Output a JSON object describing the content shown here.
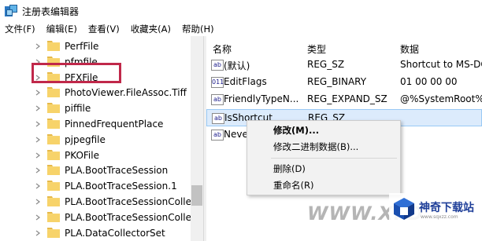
{
  "window": {
    "title": "注册表编辑器"
  },
  "menu": [
    {
      "label": "文件(F)"
    },
    {
      "label": "编辑(E)"
    },
    {
      "label": "查看(V)"
    },
    {
      "label": "收藏夹(A)"
    },
    {
      "label": "帮助(H)"
    }
  ],
  "tree": {
    "items": [
      {
        "label": "PerfFile"
      },
      {
        "label": "pfmfile"
      },
      {
        "label": "PFXFile"
      },
      {
        "label": "PhotoViewer.FileAssoc.Tiff"
      },
      {
        "label": "piffile",
        "highlighted": true
      },
      {
        "label": "PinnedFrequentPlace"
      },
      {
        "label": "pjpegfile"
      },
      {
        "label": "PKOFile"
      },
      {
        "label": "PLA.BootTraceSession"
      },
      {
        "label": "PLA.BootTraceSession.1"
      },
      {
        "label": "PLA.BootTraceSessionCollec"
      },
      {
        "label": "PLA.BootTraceSessionCollec"
      },
      {
        "label": "PLA.DataCollectorSet"
      }
    ]
  },
  "values_table": {
    "headers": {
      "name": "名称",
      "type": "类型",
      "data": "数据"
    },
    "rows": [
      {
        "icon": "string-value-icon",
        "name": "(默认)",
        "type": "REG_SZ",
        "data": "Shortcut to MS-DO"
      },
      {
        "icon": "binary-value-icon",
        "name": "EditFlags",
        "type": "REG_BINARY",
        "data": "01 00 00 00"
      },
      {
        "icon": "string-value-icon",
        "name": "FriendlyTypeN...",
        "type": "REG_EXPAND_SZ",
        "data": "@%SystemRoot%\\"
      },
      {
        "icon": "string-value-icon",
        "name": "IsShortcut",
        "type": "REG_SZ",
        "data": "",
        "selected": true
      },
      {
        "icon": "string-value-icon",
        "name": "Neve",
        "type": "",
        "data": ""
      }
    ]
  },
  "context_menu": {
    "items": [
      {
        "label": "修改(M)..."
      },
      {
        "label": "修改二进制数据(B)..."
      },
      {
        "label": "删除(D)"
      },
      {
        "label": "重命名(R)"
      }
    ]
  },
  "watermark": {
    "text": "WWW.XFD",
    "brand": "神奇下载站",
    "url": "www.sqxzz.com"
  },
  "colors": {
    "highlight_border": "#c0284a",
    "selection_bg": "#dcebfc",
    "folder_yellow": "#f8d775"
  }
}
